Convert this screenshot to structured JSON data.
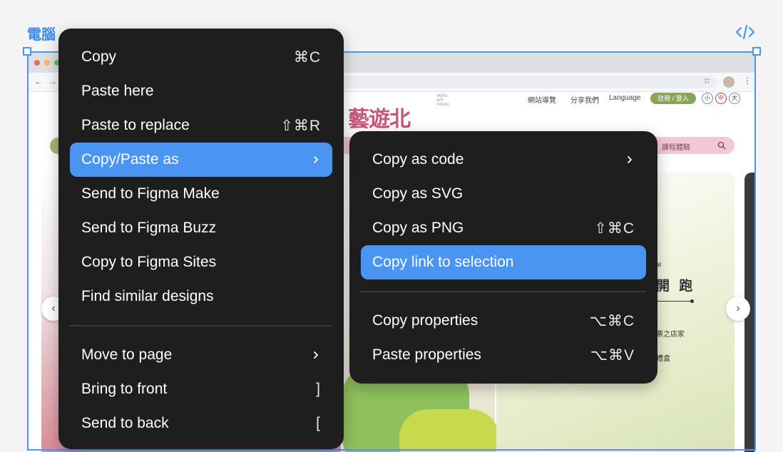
{
  "frame": {
    "label": "電腦"
  },
  "website": {
    "header_links": [
      "網站導覽",
      "分享我們",
      "Language"
    ],
    "login_label": "註冊 / 登入",
    "text_sizes": [
      "小",
      "中",
      "大"
    ],
    "logo_text": "藝遊北",
    "logo_subtext": "TAIPEI ART TRAVEL",
    "nav_item": "課程體驗",
    "slide_right": {
      "fragment_1": "al",
      "heading": "開 跑",
      "line_1": "票之店家",
      "line_2": "禮盒"
    }
  },
  "context_menu": {
    "items": [
      {
        "label": "Copy",
        "shortcut": "⌘C"
      },
      {
        "label": "Paste here",
        "shortcut": ""
      },
      {
        "label": "Paste to replace",
        "shortcut": "⇧⌘R"
      },
      {
        "label": "Copy/Paste as",
        "shortcut": "",
        "submenu": true,
        "active": true
      },
      {
        "label": "Send to Figma Make",
        "shortcut": ""
      },
      {
        "label": "Send to Figma Buzz",
        "shortcut": ""
      },
      {
        "label": "Copy to Figma Sites",
        "shortcut": ""
      },
      {
        "label": "Find similar designs",
        "shortcut": ""
      },
      {
        "label": "Move to page",
        "shortcut": "",
        "submenu": true
      },
      {
        "label": "Bring to front",
        "shortcut": "]"
      },
      {
        "label": "Send to back",
        "shortcut": "["
      }
    ]
  },
  "submenu": {
    "items": [
      {
        "label": "Copy as code",
        "shortcut": "",
        "submenu": true
      },
      {
        "label": "Copy as SVG",
        "shortcut": ""
      },
      {
        "label": "Copy as PNG",
        "shortcut": "⇧⌘C"
      },
      {
        "label": "Copy link to selection",
        "shortcut": "",
        "active": true
      },
      {
        "label": "Copy properties",
        "shortcut": "⌥⌘C"
      },
      {
        "label": "Paste properties",
        "shortcut": "⌥⌘V"
      }
    ]
  },
  "colors": {
    "accent": "#4a95f2",
    "menu_bg": "#1e1e1e",
    "logo": "#c9577a"
  }
}
